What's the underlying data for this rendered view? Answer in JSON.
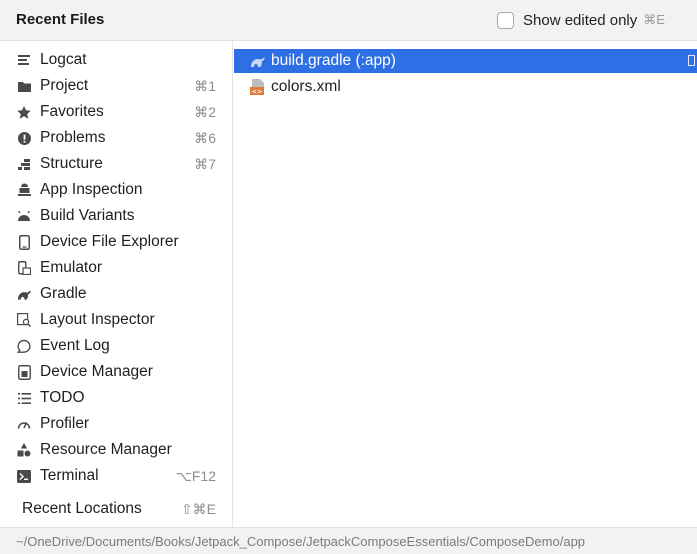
{
  "header": {
    "title": "Recent Files",
    "show_edited_label": "Show edited only",
    "show_edited_shortcut": "⌘E",
    "show_edited_checked": false
  },
  "sidebar": {
    "items": [
      {
        "label": "Logcat",
        "shortcut": "",
        "icon": "logcat-icon"
      },
      {
        "label": "Project",
        "shortcut": "⌘1",
        "icon": "folder-icon"
      },
      {
        "label": "Favorites",
        "shortcut": "⌘2",
        "icon": "star-icon"
      },
      {
        "label": "Problems",
        "shortcut": "⌘6",
        "icon": "problems-icon"
      },
      {
        "label": "Structure",
        "shortcut": "⌘7",
        "icon": "structure-icon"
      },
      {
        "label": "App Inspection",
        "shortcut": "",
        "icon": "app-inspection-icon"
      },
      {
        "label": "Build Variants",
        "shortcut": "",
        "icon": "android-icon"
      },
      {
        "label": "Device File Explorer",
        "shortcut": "",
        "icon": "device-icon"
      },
      {
        "label": "Emulator",
        "shortcut": "",
        "icon": "emulator-icon"
      },
      {
        "label": "Gradle",
        "shortcut": "",
        "icon": "gradle-icon"
      },
      {
        "label": "Layout Inspector",
        "shortcut": "",
        "icon": "layout-inspector-icon"
      },
      {
        "label": "Event Log",
        "shortcut": "",
        "icon": "speech-bubble-icon"
      },
      {
        "label": "Device Manager",
        "shortcut": "",
        "icon": "device-manager-icon"
      },
      {
        "label": "TODO",
        "shortcut": "",
        "icon": "list-icon"
      },
      {
        "label": "Profiler",
        "shortcut": "",
        "icon": "gauge-icon"
      },
      {
        "label": "Resource Manager",
        "shortcut": "",
        "icon": "shapes-icon"
      },
      {
        "label": "Terminal",
        "shortcut": "⌥F12",
        "icon": "terminal-icon"
      }
    ],
    "recent_locations_label": "Recent Locations",
    "recent_locations_shortcut": "⇧⌘E"
  },
  "files": [
    {
      "name": "build.gradle (:app)",
      "icon": "gradle-file-icon",
      "selected": true
    },
    {
      "name": "colors.xml",
      "icon": "xml-file-icon",
      "selected": false
    }
  ],
  "footer": {
    "path": "~/OneDrive/Documents/Books/Jetpack_Compose/JetpackComposeEssentials/ComposeDemo/app"
  },
  "colors": {
    "selection": "#2f6fe6",
    "header_bg": "#f2f2f2",
    "shortcut_text": "#8c8c8c"
  }
}
